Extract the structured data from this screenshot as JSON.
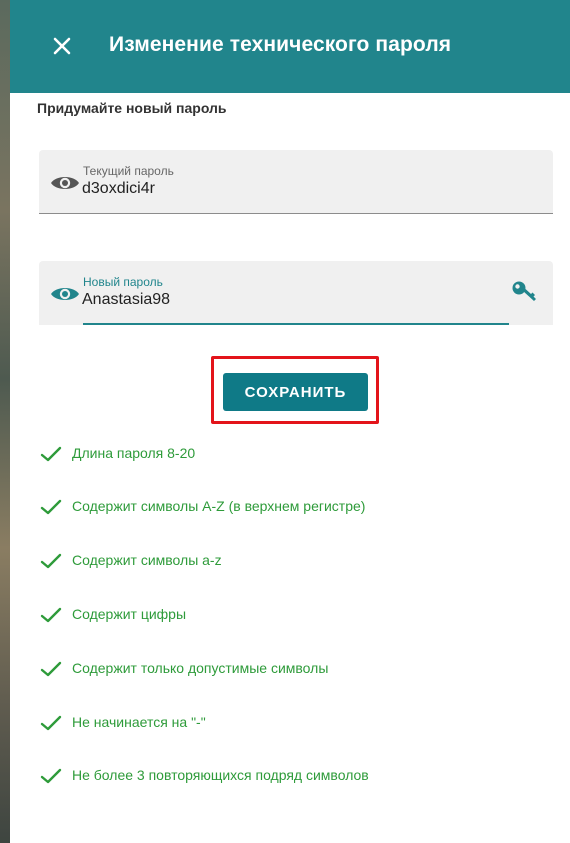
{
  "header": {
    "close_icon": "close-icon",
    "title": "Изменение технического пароля"
  },
  "subtitle": "Придумайте новый пароль",
  "current_password": {
    "label": "Текущий пароль",
    "value": "d3oxdici4r",
    "icon": "eye-icon"
  },
  "new_password": {
    "label": "Новый пароль",
    "value": "Anastasia98",
    "icon": "eye-icon",
    "generate_icon": "key-icon"
  },
  "save_button": {
    "label": "СОХРАНИТЬ"
  },
  "requirements": [
    {
      "text": "Длина пароля 8-20",
      "met": true
    },
    {
      "text": "Содержит символы A-Z (в верхнем регистре)",
      "met": true
    },
    {
      "text": "Содержит символы a-z",
      "met": true
    },
    {
      "text": "Содержит цифры",
      "met": true
    },
    {
      "text": "Содержит только допустимые символы",
      "met": true
    },
    {
      "text": "Не начинается на \"-\"",
      "met": true
    },
    {
      "text": "Не более 3 повторяющихся подряд символов",
      "met": true
    }
  ],
  "colors": {
    "header": "#21858c",
    "button": "#0f7a87",
    "success": "#2e9b3a",
    "highlight": "#e3141a"
  }
}
